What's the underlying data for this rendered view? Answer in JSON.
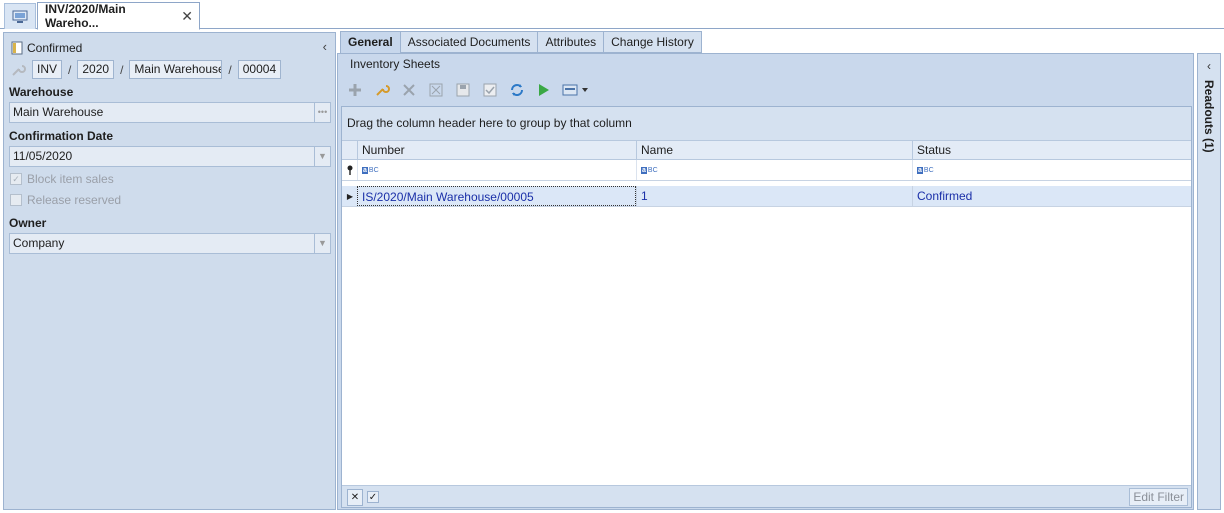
{
  "document_tab": {
    "title": "INV/2020/Main Wareho...",
    "close": "✕"
  },
  "left_panel": {
    "status": "Confirmed",
    "number": {
      "prefix": "INV",
      "year": "2020",
      "warehouse": "Main Warehouse",
      "seq": "00004",
      "sep": "/"
    },
    "warehouse_label": "Warehouse",
    "warehouse_value": "Main Warehouse",
    "confirmation_date_label": "Confirmation Date",
    "confirmation_date_value": "11/05/2020",
    "block_item_sales": "Block item sales",
    "release_reserved": "Release reserved",
    "owner_label": "Owner",
    "owner_value": "Company"
  },
  "tabs": [
    "General",
    "Associated Documents",
    "Attributes",
    "Change History"
  ],
  "sheets": {
    "title": "Inventory Sheets",
    "group_hint": "Drag the column header here to group by that column",
    "columns": [
      "Number",
      "Name",
      "Status"
    ],
    "rows": [
      {
        "number": "IS/2020/Main Warehouse/00005",
        "name": "1",
        "status": "Confirmed"
      }
    ],
    "edit_filter": "Edit Filter"
  },
  "readouts": {
    "label": "Readouts (1)"
  },
  "icons": {
    "home": "monitor-icon",
    "status": "document-icon",
    "add": "plus-icon",
    "edit": "wrench-icon",
    "delete": "x-icon",
    "refresh": "refresh-icon",
    "run": "play-icon"
  },
  "colors": {
    "panel_bg": "#cfdcec",
    "accent_text": "#1a2fa8",
    "selected_row": "#dbe7f7"
  }
}
